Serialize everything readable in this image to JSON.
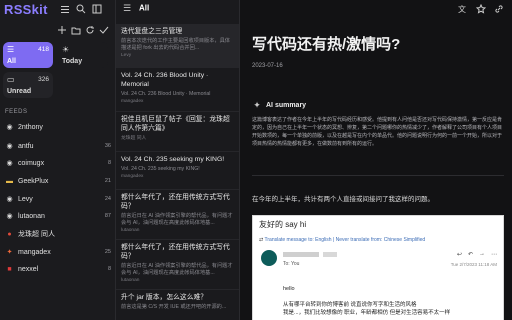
{
  "app": {
    "brand": "RSSkit"
  },
  "sidebar": {
    "tiles": [
      {
        "id": "all",
        "label": "All",
        "count": "418"
      },
      {
        "id": "today",
        "label": "Today",
        "count": ""
      },
      {
        "id": "unread",
        "label": "Unread",
        "count": "326"
      }
    ],
    "feeds_header": "FEEDS",
    "feeds": [
      {
        "name": "2nthony",
        "count": ""
      },
      {
        "name": "antfu",
        "count": "36"
      },
      {
        "name": "coimugx",
        "count": "8"
      },
      {
        "name": "GeekPlux",
        "count": "21"
      },
      {
        "name": "Levy",
        "count": "24"
      },
      {
        "name": "lutaonan",
        "count": "87"
      },
      {
        "name": "龙珠超 同人",
        "count": ""
      },
      {
        "name": "mangadex",
        "count": "25"
      },
      {
        "name": "nexxel",
        "count": "8"
      }
    ]
  },
  "list": {
    "header": "All",
    "articles": [
      {
        "title": "迭代复盘之三员管理",
        "snippet": "前言本次迭代的工作主要是回收项目版本，具体描述是把 fork 出去的代码合并回...",
        "meta": "Levy"
      },
      {
        "title": "Vol. 24 Ch. 236 Blood Unity · Memorial",
        "snippet": "Vol. 24 Ch. 236 Blood Unity · Memorial",
        "meta": "mangadex"
      },
      {
        "title": "祝佳且机巨鼠了帖子《回复：龙珠超同人作第六篇》",
        "snippet": "",
        "meta": "龙珠超 同人"
      },
      {
        "title": "Vol. 24 Ch. 235 seeking my KING!",
        "snippet": "Vol. 24 Ch. 235 seeking my KING!",
        "meta": "mangadex"
      },
      {
        "title": "都什么年代了，还在用传统方式写代码？",
        "snippet": "前言近日在 AI 油作领案引擎的帮代品，有问题才会与 AI，油问题现在高度此帐码体地基...",
        "meta": "lutaonan"
      },
      {
        "title": "都什么年代了，还在用传统方式写代码？",
        "snippet": "前言近日在 AI 油作领案引擎的帮代品，有问题才会与 AI，油问题现在高度此帐码体地基...",
        "meta": "lutaonan"
      },
      {
        "title": "升个 jar 版本，怎么这么难？",
        "snippet": "前言这是第 C/S 开发 IUE 或还开吧的开源的...",
        "meta": ""
      }
    ]
  },
  "content": {
    "title": "写代码还有热/激情吗?",
    "date": "2023-07-16",
    "ai_summary_label": "AI summary",
    "ai_summary": "这篇博客表达了作者在今年上半年的写代码经历和感受。他提到有人问他是否还对写代码保持激情，第一反应是肯定的，因为自己在上半年一个状态的冥想、辨复，第二个问题哪你的热情减少了，作者解释了公司项目有个人项目开始数项的，每一个单独的前版，以及在越是写在内个的单品代。他的问题说明行为何的一前一个开始，所以对于项目热情的热情能都有更多，在做数前有到所有的运行。",
    "paragraph": "在今年的上半年，共计有两个人直接或间接问了我这样的问题。",
    "email": {
      "subject": "友好的 say hi",
      "translate_text": "Translate message to: English",
      "translate_rest": "| Never translate from: Chinese Simplified",
      "to": "To: You",
      "date": "Tue 2/7/2023 11:18 AM",
      "hello": "hello",
      "line1": "从有哪平台转到你的博客前 说直说你写字和生活的风格",
      "line2": "我是...，我们比较想像的 职业，年龄都相仿 但是对生活容易不太一样"
    }
  }
}
